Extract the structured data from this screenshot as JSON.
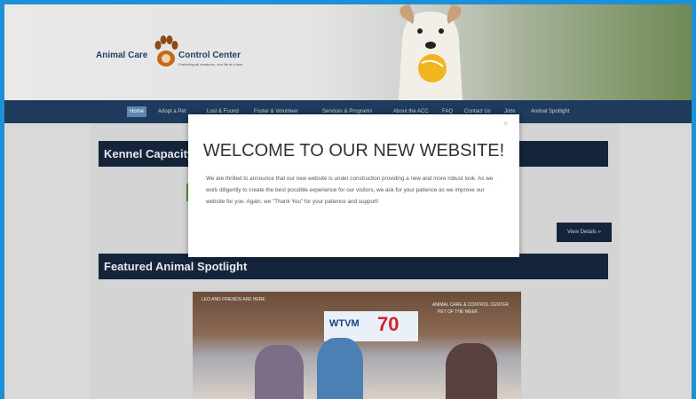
{
  "logo": {
    "left_text": "Animal Care",
    "right_text": "Control Center",
    "tagline": "Protecting all creatures, one life at a time"
  },
  "nav": {
    "items": [
      {
        "label": "Home"
      },
      {
        "label": "Adopt a Pet"
      },
      {
        "label": "Lost & Found"
      },
      {
        "label": "Foster & Volunteer"
      },
      {
        "label": "Services & Programs"
      },
      {
        "label": "About the ACC"
      },
      {
        "label": "FAQ"
      },
      {
        "label": "Contact Us"
      },
      {
        "label": "Jobs"
      },
      {
        "label": "Animal Spotlight"
      }
    ]
  },
  "sections": {
    "kennel_title": "Kennel Capacity",
    "view_details": "View Details »",
    "spotlight_title": "Featured Animal Spotlight"
  },
  "video": {
    "caption_left": "LEO AND FRIENDS ARE HERE",
    "caption_right": "ANIMAL CARE & CONTROL CENTER",
    "caption_right2": "PET OF THE WEEK",
    "station": "WTVM",
    "channel": "70"
  },
  "modal": {
    "title": "WELCOME TO OUR NEW WEBSITE!",
    "body": "We are thrilled to announce that our new website is under construction providing a new and more robust look. As we work diligently to create the best possible experience for our visitors, we ask for your patience as we improve our website for you. Again, we \"Thank You\" for your patience and support!",
    "close": "×"
  }
}
